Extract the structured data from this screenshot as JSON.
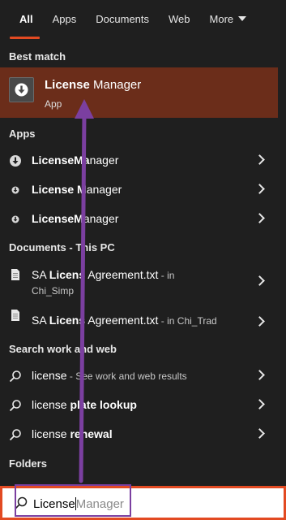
{
  "tabs": [
    {
      "label": "All",
      "active": true
    },
    {
      "label": "Apps"
    },
    {
      "label": "Documents"
    },
    {
      "label": "Web"
    },
    {
      "label": "More"
    }
  ],
  "best_match": {
    "header": "Best match",
    "title_bold": "License",
    "title_rest": " Manager",
    "subtitle": "App"
  },
  "apps": {
    "header": "Apps",
    "items": [
      {
        "bold": "LicenseMa",
        "rest": "nager"
      },
      {
        "bold": "License M",
        "rest": "anager"
      },
      {
        "bold": "LicenseM",
        "rest": "anager"
      }
    ]
  },
  "documents": {
    "header": "Documents - This PC",
    "items": [
      {
        "pre": "SA ",
        "bold": "Licens",
        "rest": " Agreement.txt",
        "suffix": " - in",
        "line2": "Chi_Simp"
      },
      {
        "pre": "SA ",
        "bold": "Licens",
        "rest": " Agreement.txt",
        "suffix": " - in Chi_Trad",
        "line2": ""
      }
    ]
  },
  "web": {
    "header": "Search work and web",
    "items": [
      {
        "bold": "",
        "plain": "license",
        "suffix": " - See work and web results"
      },
      {
        "plain": "license ",
        "bold": "plate lookup",
        "suffix": ""
      },
      {
        "plain": "license ",
        "bold": "renewal",
        "suffix": ""
      }
    ]
  },
  "folders": {
    "header": "Folders"
  },
  "search": {
    "typed": "License",
    "ghost": "Manager"
  },
  "colors": {
    "accent": "#e24a22",
    "best_match_bg": "#6b2d1a",
    "annotation": "#7b3fa0"
  }
}
